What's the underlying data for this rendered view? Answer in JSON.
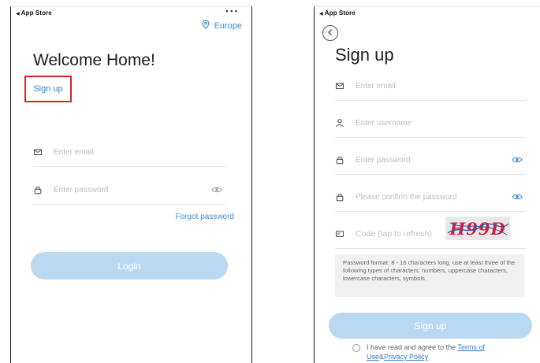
{
  "left_screen": {
    "status_text": "App Store",
    "region_label": "Europe",
    "welcome_title": "Welcome Home!",
    "signup_link": "Sign up",
    "email_placeholder": "Enter email",
    "password_placeholder": "Enter password",
    "forgot_password": "Forgot password",
    "login_button": "Login"
  },
  "right_screen": {
    "status_text": "App Store",
    "title": "Sign up",
    "email_placeholder": "Enter email",
    "username_placeholder": "Enter username",
    "password_placeholder": "Enter password",
    "confirm_placeholder": "Please confirm the password",
    "code_placeholder": "Code (tap to refresh)",
    "captcha_text": "H99D",
    "password_hint": "Password format: 8 - 16 characters long, use at least three of the following types of characters: numbers, uppercase characters, lowercase characters, symbols.",
    "signup_button": "Sign up",
    "agree_text": "I have read and agree to the",
    "terms_link": "Terms of Use",
    "ampersand": "&",
    "privacy_link": "Privacy Policy"
  },
  "colors": {
    "accent_blue": "#3d8fd8",
    "button_disabled": "#b9d9f3",
    "highlight_red": "#d32727",
    "captcha_red": "#d61f3a"
  },
  "icons": [
    "location-pin-icon",
    "mail-icon",
    "lock-icon",
    "eye-icon",
    "user-icon",
    "captcha-icon",
    "back-chevron-icon"
  ]
}
